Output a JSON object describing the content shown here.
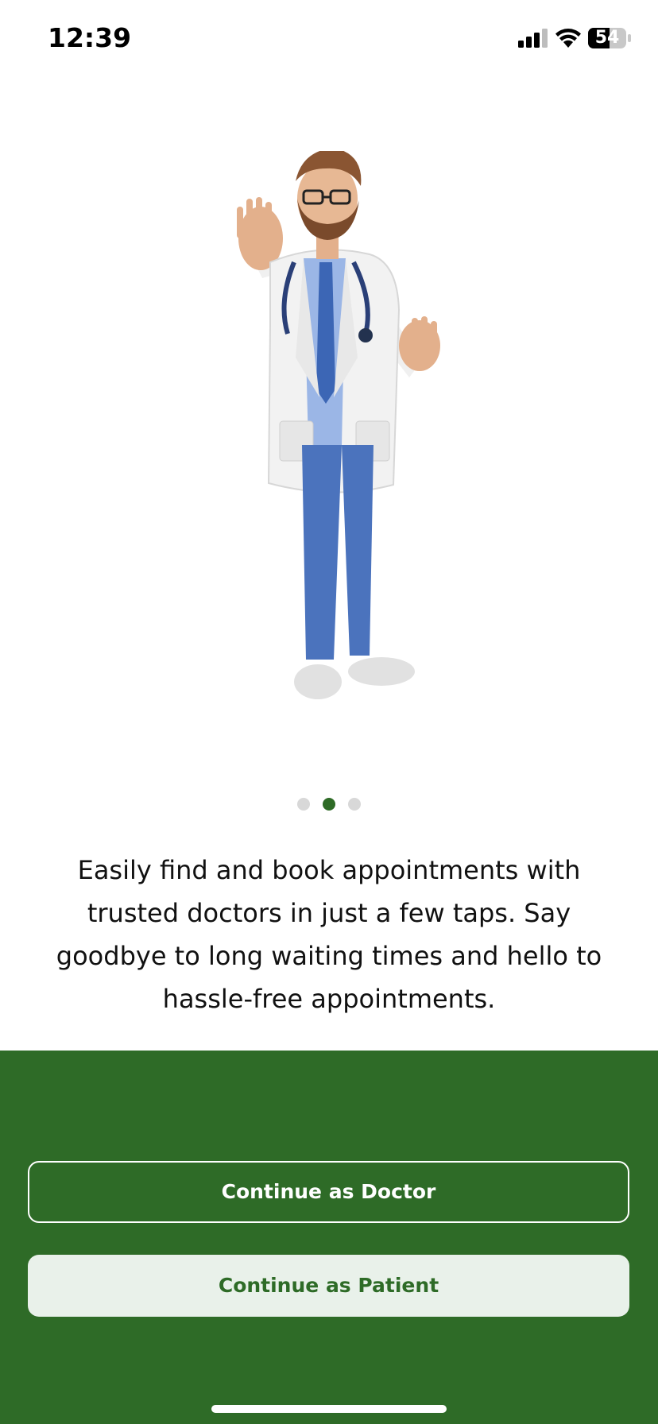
{
  "status_bar": {
    "time": "12:39",
    "battery": "54"
  },
  "carousel": {
    "page_count": 3,
    "active_page_index": 1
  },
  "description": "Easily find and book appointments with trusted doctors in just a few taps. Say goodbye to long waiting times and hello to hassle-free appointments.",
  "actions": {
    "doctor_label": "Continue as Doctor",
    "patient_label": "Continue as Patient"
  },
  "colors": {
    "brand_green": "#2e6b27",
    "patient_button_bg": "#e9f1ea",
    "dot_inactive": "#d8d8d8"
  },
  "icons": [
    "signal-icon",
    "wifi-icon",
    "battery-icon",
    "doctor-illustration"
  ]
}
